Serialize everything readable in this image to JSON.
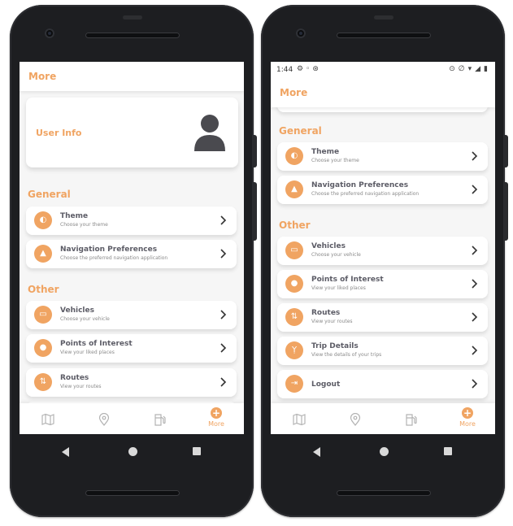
{
  "left": {
    "appbar_title": "More",
    "user_info_label": "User Info",
    "general_title": "General",
    "other_title": "Other",
    "general_items": [
      {
        "title": "Theme",
        "subtitle": "Choose your theme",
        "icon": "theme-icon"
      },
      {
        "title": "Navigation Preferences",
        "subtitle": "Choose the preferred navigation application",
        "icon": "navigation-arrow-icon"
      }
    ],
    "other_items": [
      {
        "title": "Vehicles",
        "subtitle": "Choose your vehicle",
        "icon": "car-icon"
      },
      {
        "title": "Points of Interest",
        "subtitle": "View your liked places",
        "icon": "location-pin-icon"
      },
      {
        "title": "Routes",
        "subtitle": "View your routes",
        "icon": "routes-icon"
      }
    ],
    "nav_more_label": "More"
  },
  "right": {
    "status_time": "1:44",
    "appbar_title": "More",
    "general_title": "General",
    "other_title": "Other",
    "general_items": [
      {
        "title": "Theme",
        "subtitle": "Choose your theme",
        "icon": "theme-icon"
      },
      {
        "title": "Navigation Preferences",
        "subtitle": "Choose the preferred navigation application",
        "icon": "navigation-arrow-icon"
      }
    ],
    "other_items": [
      {
        "title": "Vehicles",
        "subtitle": "Choose your vehicle",
        "icon": "car-icon"
      },
      {
        "title": "Points of Interest",
        "subtitle": "View your liked places",
        "icon": "location-pin-icon"
      },
      {
        "title": "Routes",
        "subtitle": "View your routes",
        "icon": "routes-icon"
      },
      {
        "title": "Trip Details",
        "subtitle": "View the details of your trips",
        "icon": "trip-icon"
      },
      {
        "title": "Logout",
        "icon": "logout-icon"
      }
    ],
    "nav_more_label": "More"
  },
  "colors": {
    "accent": "#f0a462",
    "background": "#f6f6f6",
    "card": "#ffffff",
    "title_text": "#5c5c66"
  }
}
